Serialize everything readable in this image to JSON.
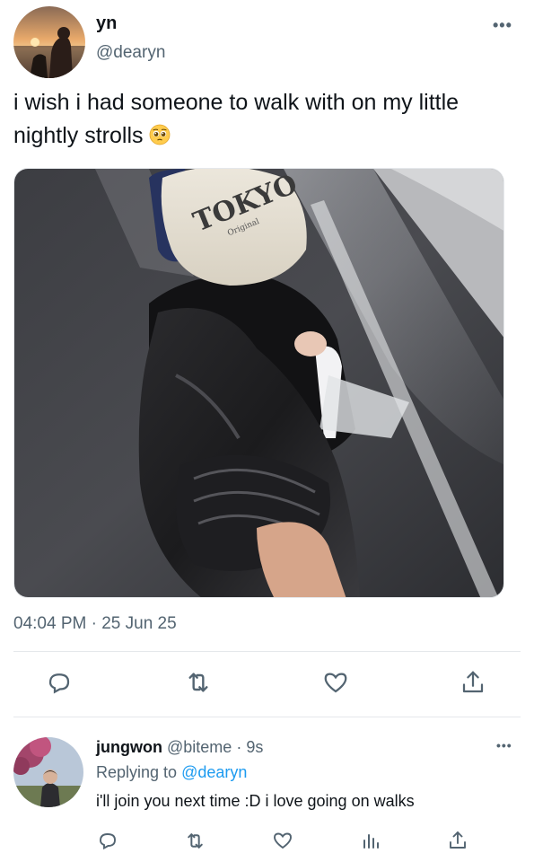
{
  "tweet": {
    "name": "yn",
    "handle": "@dearyn",
    "more": "•••",
    "text": "i wish i had someone to walk with on my little nightly strolls",
    "emoji": "pleading-face-emoji",
    "media": {
      "cap_text": "TOKYO",
      "cap_subtext": "Original"
    },
    "timestamp": "04:04 PM · 25 Jun 25",
    "actions": [
      "reply-icon",
      "retweet-icon",
      "like-icon",
      "share-icon"
    ]
  },
  "reply": {
    "name": "jungwon",
    "handle": "@biteme",
    "time": "· 9s",
    "replying_prefix": "Replying to",
    "replying_to": "@dearyn",
    "text": "i'll join you next time :D i love going on walks",
    "more": "•••",
    "actions": [
      "reply-icon",
      "retweet-icon",
      "like-icon",
      "analytics-icon",
      "share-icon"
    ]
  },
  "colors": {
    "text": "#0f1419",
    "secondary": "#536471",
    "link": "#1d9bf0",
    "divider": "#e5e8eb"
  }
}
